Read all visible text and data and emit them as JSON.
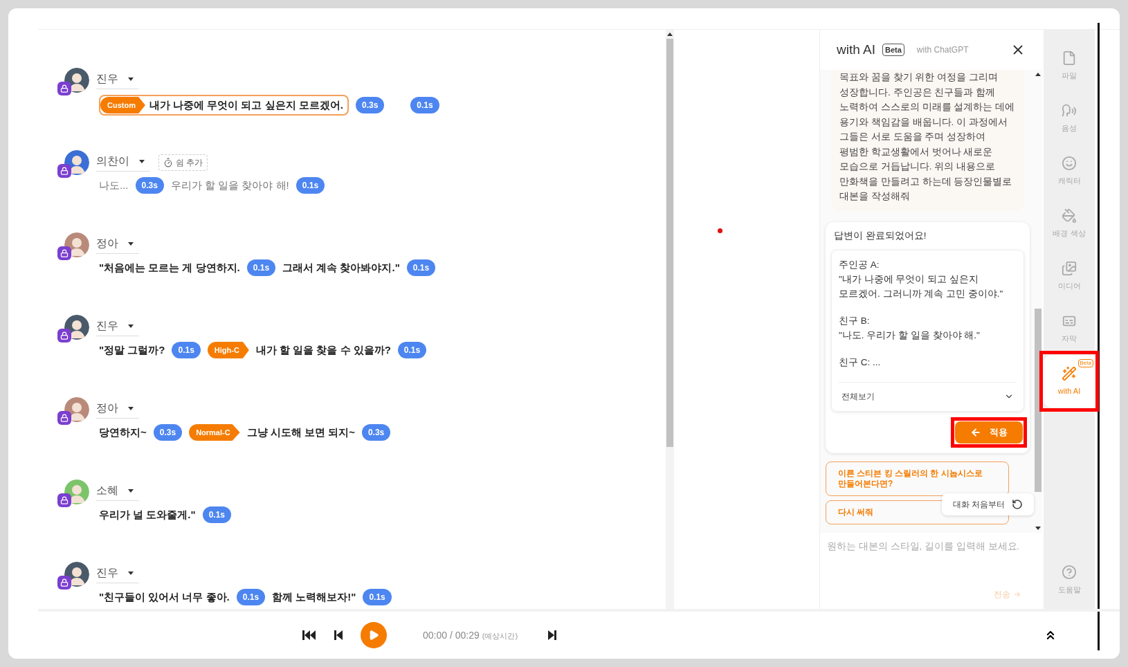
{
  "script": {
    "rows": [
      {
        "name": "진우",
        "color": "#4a5a6a",
        "segments": [
          {
            "kind": "tagged",
            "tag": "Custom",
            "text": "내가 나중에 무엇이 되고 싶은지 모르겠어."
          },
          {
            "kind": "pause",
            "text": "0.3s"
          },
          {
            "kind": "gap"
          },
          {
            "kind": "pause",
            "text": "0.1s"
          }
        ]
      },
      {
        "name": "의찬이",
        "color": "#3b6fd6",
        "add_pause": "쉼 추가",
        "segments": [
          {
            "kind": "text",
            "text": "나도...",
            "dimmed": true
          },
          {
            "kind": "pause",
            "text": "0.3s"
          },
          {
            "kind": "text",
            "text": "우리가 할 일을 찾아야 해!",
            "dimmed": true
          },
          {
            "kind": "pause",
            "text": "0.1s"
          }
        ]
      },
      {
        "name": "정아",
        "color": "#b98a7a",
        "segments": [
          {
            "kind": "text",
            "text": "\"처음에는 모르는 게 당연하지.",
            "dimmed": false
          },
          {
            "kind": "pause",
            "text": "0.1s"
          },
          {
            "kind": "text",
            "text": "그래서 계속 찾아봐야지.\"",
            "dimmed": false
          },
          {
            "kind": "pause",
            "text": "0.1s"
          }
        ]
      },
      {
        "name": "진우",
        "color": "#4a5a6a",
        "segments": [
          {
            "kind": "text",
            "text": "\"정말 그럴까?",
            "dimmed": false
          },
          {
            "kind": "pause",
            "text": "0.1s"
          },
          {
            "kind": "tag",
            "text": "High-C"
          },
          {
            "kind": "text",
            "text": "내가 할 일을 찾을 수 있을까?",
            "dimmed": false
          },
          {
            "kind": "pause",
            "text": "0.1s"
          }
        ]
      },
      {
        "name": "정아",
        "color": "#b98a7a",
        "segments": [
          {
            "kind": "text",
            "text": "당연하지~",
            "dimmed": false
          },
          {
            "kind": "pause",
            "text": "0.3s"
          },
          {
            "kind": "tag",
            "text": "Normal-C"
          },
          {
            "kind": "text",
            "text": "그냥 시도해 보면 되지~",
            "dimmed": false
          },
          {
            "kind": "pause",
            "text": "0.3s"
          }
        ]
      },
      {
        "name": "소혜",
        "color": "#7cc46a",
        "segments": [
          {
            "kind": "text",
            "text": "우리가 널 도와줄게.\"",
            "dimmed": false
          },
          {
            "kind": "pause",
            "text": "0.1s"
          }
        ]
      },
      {
        "name": "진우",
        "color": "#4a5a6a",
        "segments": [
          {
            "kind": "text",
            "text": "\"친구들이 있어서 너무 좋아.",
            "dimmed": false
          },
          {
            "kind": "pause",
            "text": "0.1s"
          },
          {
            "kind": "text",
            "text": "함께 노력해보자!\"",
            "dimmed": false
          },
          {
            "kind": "pause",
            "text": "0.1s"
          }
        ]
      }
    ]
  },
  "ai_panel": {
    "title": "with AI",
    "badge": "Beta",
    "subtitle": "with ChatGPT",
    "user_message": "목표와 꿈을 찾기 위한 여정을 그리며 성장합니다. 주인공은 친구들과 함께 노력하여 스스로의 미래를 설계하는 데에 용기와 책임감을 배웁니다. 이 과정에서 그들은 서로 도움을 주며 성장하여 평범한 학교생활에서 벗어나 새로운 모습으로 거듭납니다. 위의 내용으로 만화책을 만들려고 하는데 등장인물별로 대본을 작성해줘",
    "answer": {
      "status": "답변이 완료되었어요!",
      "blocks": [
        [
          "주인공 A:",
          "\"내가 나중에 무엇이 되고 싶은지 모르겠어. 그러니까 계속 고민 중이야.\""
        ],
        [
          "친구 B:",
          "\"나도. 우리가 할 일을 찾아야 해.\""
        ],
        [
          "친구 C: ..."
        ]
      ],
      "expand": "전체보기",
      "apply": {
        "label": "적용",
        "highlighted": true
      }
    },
    "suggestions": [
      "이른 스티븐 킹 스릴러의 한 시놉시스로 만들어본다면?",
      "다시 써줘"
    ],
    "restart": "대화 처음부터",
    "input": {
      "placeholder": "원하는 대본의 스타일, 길이를 입력해 보세요.",
      "send": "전송",
      "send_disabled": true
    }
  },
  "sidebar": {
    "items": [
      {
        "kind": "file",
        "label": "파일",
        "selected": false,
        "highlighted": false
      },
      {
        "kind": "voice",
        "label": "음성",
        "selected": false,
        "highlighted": false
      },
      {
        "kind": "character",
        "label": "캐릭터",
        "selected": false,
        "highlighted": false
      },
      {
        "kind": "background",
        "label": "배경 색상",
        "selected": false,
        "highlighted": false
      },
      {
        "kind": "media",
        "label": "미디어",
        "selected": false,
        "highlighted": false
      },
      {
        "kind": "subtitle",
        "label": "자막",
        "selected": false,
        "highlighted": false
      },
      {
        "kind": "ai",
        "label": "with AI",
        "selected": true,
        "badge": "Beta",
        "highlighted": true
      }
    ],
    "help": "도움말"
  },
  "player": {
    "time": "00:00 / 00:29",
    "note": "(예상시간)"
  }
}
